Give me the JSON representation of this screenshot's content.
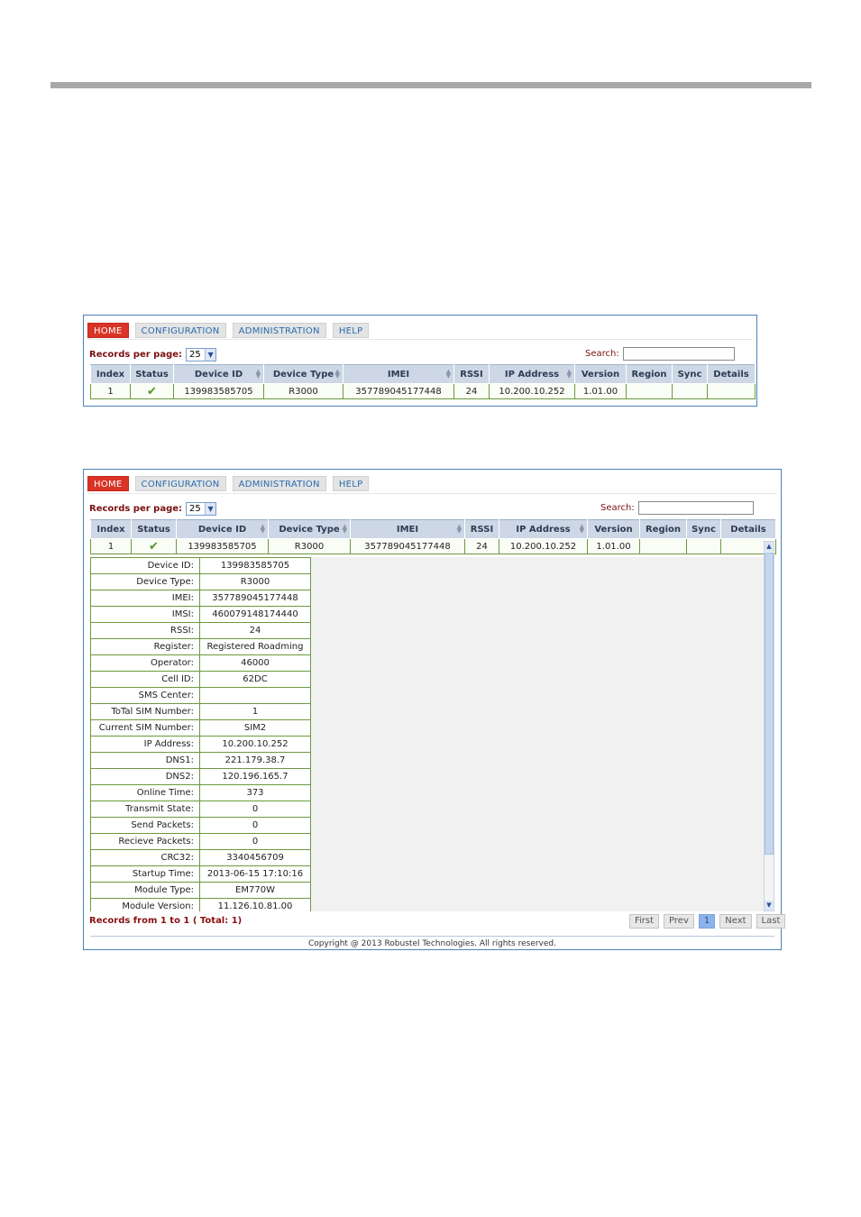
{
  "nav": {
    "tabs": [
      "HOME",
      "CONFIGURATION",
      "ADMINISTRATION",
      "HELP"
    ]
  },
  "toolbar": {
    "records_label": "Records per page:",
    "records_value": "25",
    "search_label": "Search:",
    "search_value": ""
  },
  "table": {
    "columns": [
      "Index",
      "Status",
      "Device ID",
      "Device Type",
      "IMEI",
      "RSSI",
      "IP Address",
      "Version",
      "Region",
      "Sync",
      "Details"
    ],
    "rows": [
      {
        "index": "1",
        "status_icon": "check-icon",
        "device_id": "139983585705",
        "device_type": "R3000",
        "imei": "357789045177448",
        "rssi": "24",
        "ip": "10.200.10.252",
        "version": "1.01.00",
        "region": "",
        "sync": "",
        "details": ""
      }
    ]
  },
  "details": [
    {
      "label": "Device ID:",
      "value": "139983585705"
    },
    {
      "label": "Device Type:",
      "value": "R3000"
    },
    {
      "label": "IMEI:",
      "value": "357789045177448"
    },
    {
      "label": "IMSI:",
      "value": "460079148174440"
    },
    {
      "label": "RSSI:",
      "value": "24"
    },
    {
      "label": "Register:",
      "value": "Registered Roadming"
    },
    {
      "label": "Operator:",
      "value": "46000"
    },
    {
      "label": "Cell ID:",
      "value": "62DC"
    },
    {
      "label": "SMS Center:",
      "value": ""
    },
    {
      "label": "ToTal SIM Number:",
      "value": "1"
    },
    {
      "label": "Current SIM Number:",
      "value": "SIM2"
    },
    {
      "label": "IP Address:",
      "value": "10.200.10.252"
    },
    {
      "label": "DNS1:",
      "value": "221.179.38.7"
    },
    {
      "label": "DNS2:",
      "value": "120.196.165.7"
    },
    {
      "label": "Online Time:",
      "value": "373"
    },
    {
      "label": "Transmit State:",
      "value": "0"
    },
    {
      "label": "Send Packets:",
      "value": "0"
    },
    {
      "label": "Recieve Packets:",
      "value": "0"
    },
    {
      "label": "CRC32:",
      "value": "3340456709"
    },
    {
      "label": "Startup Time:",
      "value": "2013-06-15 17:10:16"
    },
    {
      "label": "Module Type:",
      "value": "EM770W"
    },
    {
      "label": "Module Version:",
      "value": "11.126.10.81.00"
    }
  ],
  "records_summary": "Records from 1 to 1 ( Total: 1)",
  "pager": [
    "First",
    "Prev",
    "1",
    "Next",
    "Last"
  ],
  "pager_current": "1",
  "copyright": "Copyright @ 2013 Robustel Technologies. All rights reserved.",
  "colors": {
    "active_tab": "#d93426",
    "tab_text": "#2a6db0",
    "header_bg": "#cdd7e6",
    "row_border": "#6b9a3e",
    "status_ok": "#4a9a1f"
  }
}
